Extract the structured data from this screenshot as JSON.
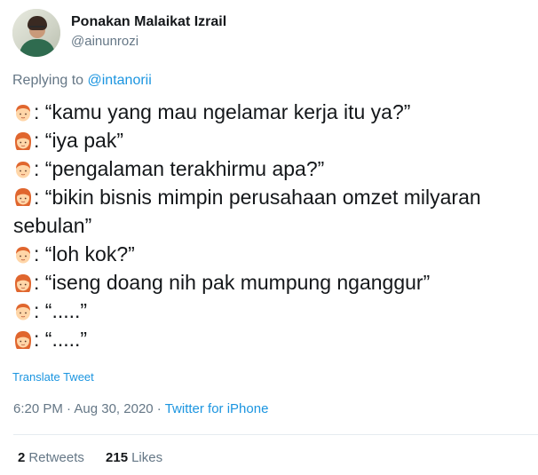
{
  "user": {
    "display_name": "Ponakan Malaikat Izrail",
    "handle": "@ainunrozi"
  },
  "reply": {
    "prefix": "Replying to ",
    "mention": "@intanorii"
  },
  "lines": [
    {
      "speaker": "man-emoji",
      "text": ": “kamu yang mau ngelamar kerja itu ya?”"
    },
    {
      "speaker": "woman-emoji",
      "text": ": “iya pak”"
    },
    {
      "speaker": "man-emoji",
      "text": ": “pengalaman terakhirmu apa?”"
    },
    {
      "speaker": "woman-emoji",
      "text": ": “bikin bisnis mimpin perusahaan omzet milyaran sebulan”"
    },
    {
      "speaker": "man-emoji",
      "text": ": “loh kok?”"
    },
    {
      "speaker": "woman-emoji",
      "text": ": “iseng doang nih pak mumpung nganggur”"
    },
    {
      "speaker": "man-emoji",
      "text": ": “.....”"
    },
    {
      "speaker": "woman-emoji",
      "text": ": “.....”"
    }
  ],
  "translate_label": "Translate Tweet",
  "meta": {
    "time": "6:20 PM",
    "sep1": " · ",
    "date": "Aug 30, 2020",
    "sep2": " · ",
    "source": "Twitter for iPhone"
  },
  "stats": {
    "retweets_count": "2",
    "retweets_label": "Retweets",
    "likes_count": "215",
    "likes_label": "Likes"
  },
  "colors": {
    "link": "#1b95e0",
    "muted": "#657786",
    "text": "#14171a"
  }
}
